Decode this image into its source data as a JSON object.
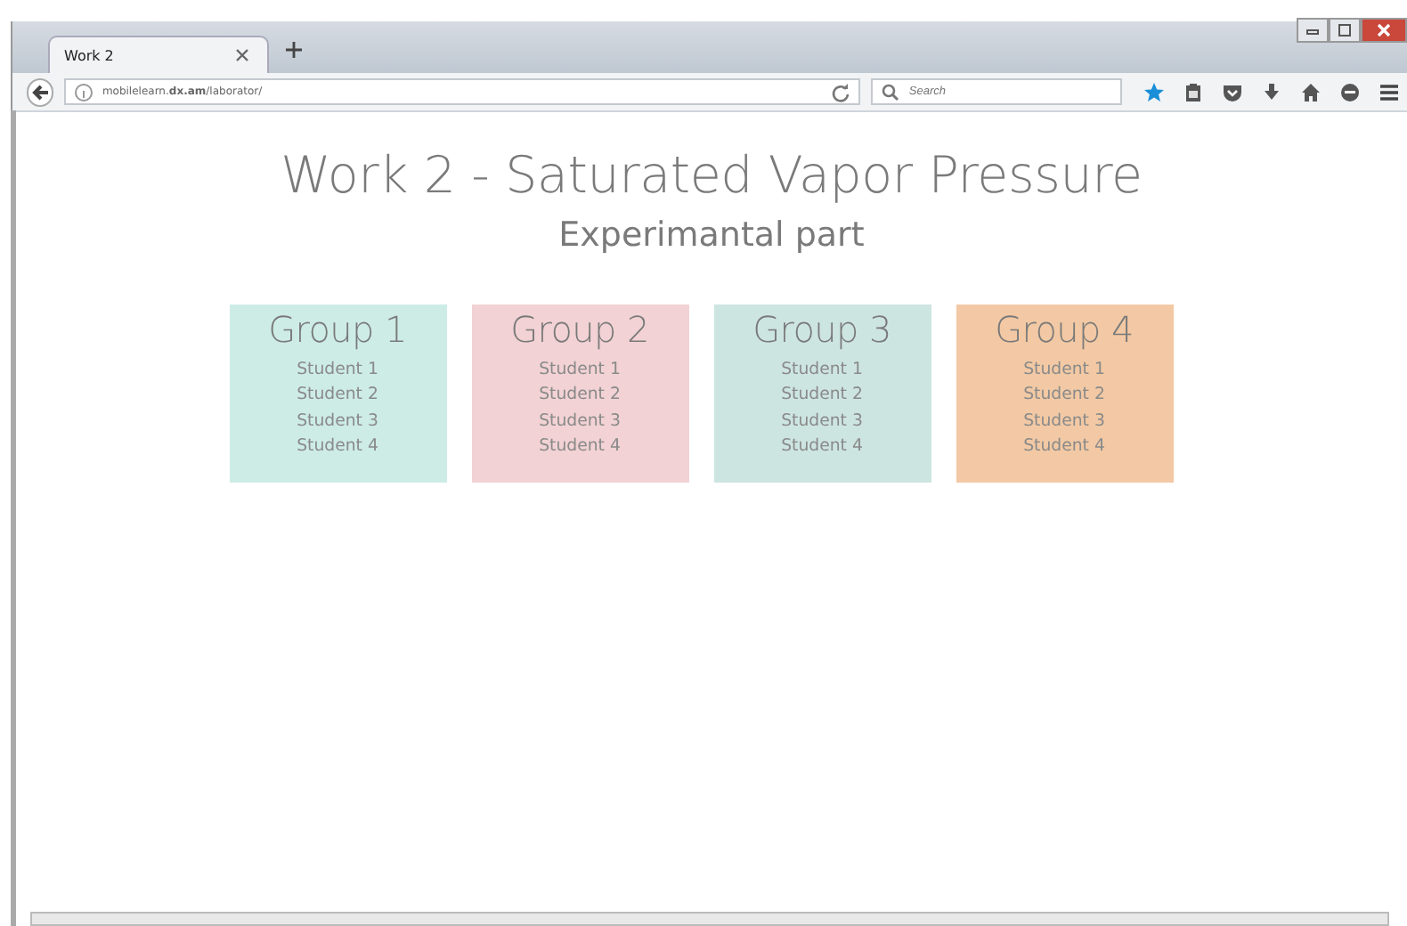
{
  "browser": {
    "tabs": [
      {
        "title": "Work 2",
        "selected": true
      }
    ],
    "url": "mobilelearn.**dx.am**/laborator/",
    "search": {
      "placeholder": "Search"
    }
  },
  "page": {
    "title": "Work 2 - Saturated Vapor Pressure",
    "subtitle": "Experimantal part",
    "groups": [
      {
        "name": "Group 1",
        "color": "#cdece6",
        "students": [
          "Student 1",
          "Student 2",
          "Student 3",
          "Student 4"
        ]
      },
      {
        "name": "Group 2",
        "color": "#f2d2d4",
        "students": [
          "Student 1",
          "Student 2",
          "Student 3",
          "Student 4"
        ]
      },
      {
        "name": "Group 3",
        "color": "#cde5e1",
        "students": [
          "Student 1",
          "Student 2",
          "Student 3",
          "Student 4"
        ]
      },
      {
        "name": "Group 4",
        "color": "#f2c9a4",
        "students": [
          "Student 1",
          "Student 2",
          "Student 3",
          "Student 4"
        ]
      }
    ]
  }
}
